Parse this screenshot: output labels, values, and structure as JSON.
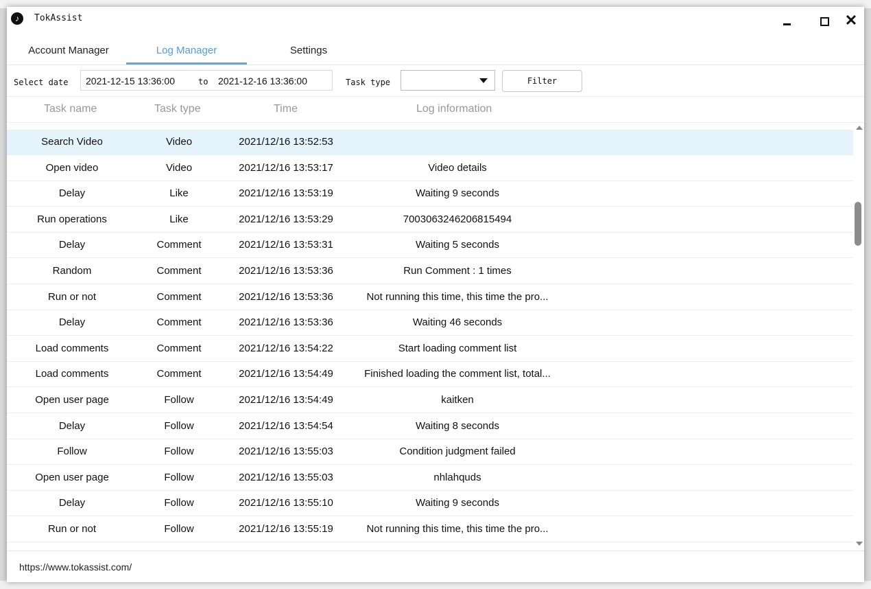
{
  "window": {
    "title": "TokAssist",
    "logo": "tiktok-logo-icon"
  },
  "tabs": [
    "Account Manager",
    "Log Manager",
    "Settings"
  ],
  "active_tab": "Log Manager",
  "filter": {
    "select_date_label": "Select date",
    "start": "2021-12-15 13:36:00",
    "to_label": "to",
    "end": "2021-12-16 13:36:00",
    "task_type_label": "Task type",
    "task_type_value": "",
    "button": "Filter"
  },
  "columns": [
    "Task name",
    "Task type",
    "Time",
    "Log information"
  ],
  "rows": [
    {
      "name": "Search Video",
      "type": "Video",
      "time": "2021/12/16 13:52:53",
      "log": ""
    },
    {
      "name": "Open video",
      "type": "Video",
      "time": "2021/12/16 13:53:17",
      "log": "Video details"
    },
    {
      "name": "Delay",
      "type": "Like",
      "time": "2021/12/16 13:53:19",
      "log": "Waiting 9 seconds"
    },
    {
      "name": "Run operations",
      "type": "Like",
      "time": "2021/12/16 13:53:29",
      "log": "7003063246206815494"
    },
    {
      "name": "Delay",
      "type": "Comment",
      "time": "2021/12/16 13:53:31",
      "log": "Waiting 5 seconds"
    },
    {
      "name": "Random",
      "type": "Comment",
      "time": "2021/12/16 13:53:36",
      "log": "Run Comment : 1 times"
    },
    {
      "name": "Run or not",
      "type": "Comment",
      "time": "2021/12/16 13:53:36",
      "log": "Not running this time, this time the pro..."
    },
    {
      "name": "Delay",
      "type": "Comment",
      "time": "2021/12/16 13:53:36",
      "log": "Waiting 46 seconds"
    },
    {
      "name": "Load comments",
      "type": "Comment",
      "time": "2021/12/16 13:54:22",
      "log": "Start loading comment list"
    },
    {
      "name": "Load comments",
      "type": "Comment",
      "time": "2021/12/16 13:54:49",
      "log": "Finished loading the comment list, total..."
    },
    {
      "name": "Open user page",
      "type": "Follow",
      "time": "2021/12/16 13:54:49",
      "log": "kaitken"
    },
    {
      "name": "Delay",
      "type": "Follow",
      "time": "2021/12/16 13:54:54",
      "log": "Waiting 8 seconds"
    },
    {
      "name": "Follow",
      "type": "Follow",
      "time": "2021/12/16 13:55:03",
      "log": "Condition judgment failed"
    },
    {
      "name": "Open user page",
      "type": "Follow",
      "time": "2021/12/16 13:55:03",
      "log": "nhlahquds"
    },
    {
      "name": "Delay",
      "type": "Follow",
      "time": "2021/12/16 13:55:10",
      "log": "Waiting 9 seconds"
    },
    {
      "name": "Run or not",
      "type": "Follow",
      "time": "2021/12/16 13:55:19",
      "log": "Not running this time, this time the pro..."
    }
  ],
  "selected_row_index": 0,
  "footer": {
    "url": "https://www.tokassist.com/"
  },
  "colors": {
    "accent": "#4a9fe6",
    "selected_row": "#e5f3fc",
    "header_text": "#999999"
  }
}
